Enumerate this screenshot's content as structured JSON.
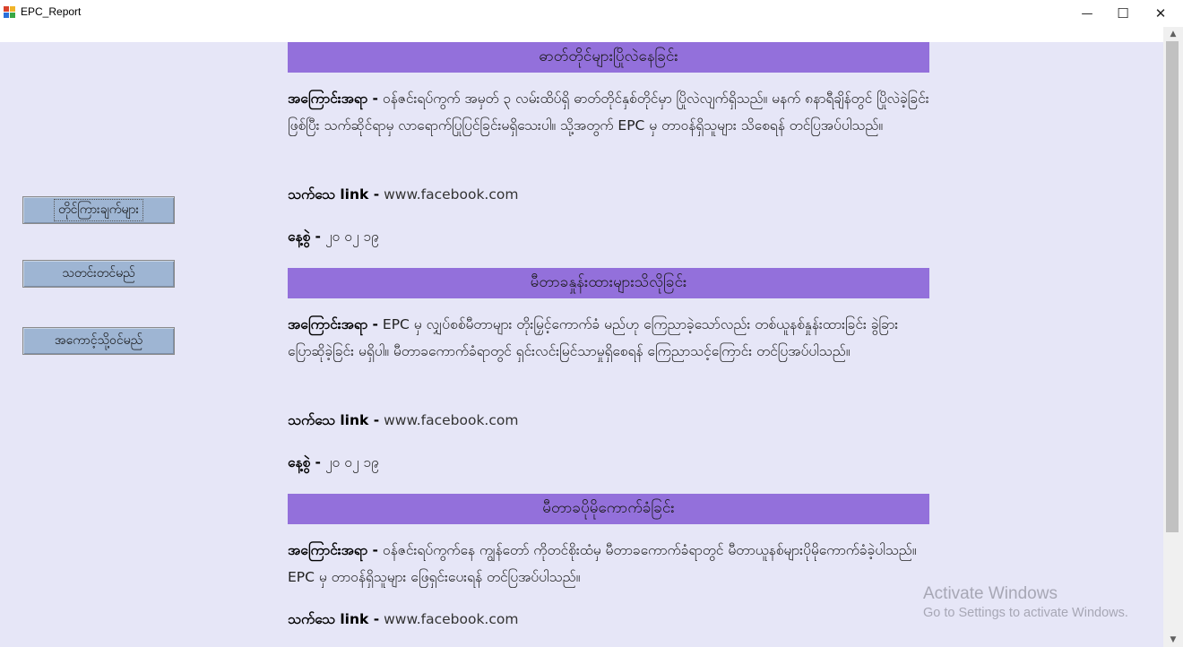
{
  "window": {
    "title": "EPC_Report",
    "minimize": "—",
    "maximize": "☐",
    "close": "✕"
  },
  "sidebar": {
    "buttons": [
      {
        "label": "တိုင်ကြားချက်များ"
      },
      {
        "label": "သတင်းတင်မည်"
      },
      {
        "label": "အကောင့်သို့ဝင်မည်"
      }
    ]
  },
  "posts": [
    {
      "title": "ဓာတ်တိုင်များပြိုလဲနေခြင်း",
      "reason_label": "အကြောင်းအရာ -",
      "reason_text": "ဝန်ဇင်းရပ်ကွက် အမှတ် ၃ လမ်းထိပ်ရှိ ဓာတ်တိုင်နှစ်တိုင်မှာ ပြိုလဲလျက်ရှိသည်။ မနက် ၈နာရီချိန်တွင် ပြိုလဲခဲ့ခြင်း ဖြစ်ပြီး သက်ဆိုင်ရာမှ လာရောက်ပြုပြင်ခြင်းမရှိသေးပါ။ သို့အတွက် EPC မှ တာဝန်ရှိသူများ သိစေရန် တင်ပြအပ်ပါသည်။",
      "link_label": "သက်သေ link -",
      "link_value": "www.facebook.com",
      "date_label": "နေ့စွဲ -",
      "date_value": "၂၀ ၀၂ ၁၉"
    },
    {
      "title": "မီတာခနှုန်းထားများသိလိုခြင်း",
      "reason_label": "အကြောင်းအရာ -",
      "reason_text": "EPC မှ လျှပ်စစ်မီတာများ တိုးမြှင့်ကောက်ခံ မည်ဟု ကြေညာခဲ့သော်လည်း တစ်ယူနစ်နှုန်းထားခြင်း ခွဲခြားပြောဆိုခဲ့ခြင်း မရှိပါ။ မီတာခကောက်ခံရာတွင် ရှင်းလင်းမြင်သာမှုရှိစေရန် ကြေညာသင့်ကြောင်း တင်ပြအပ်ပါသည်။",
      "link_label": "သက်သေ link -",
      "link_value": "www.facebook.com",
      "date_label": "နေ့စွဲ -",
      "date_value": "၂၀ ၀၂ ၁၉"
    },
    {
      "title": "မီတာခပိုမိုကောက်ခံခြင်း",
      "reason_label": "အကြောင်းအရာ -",
      "reason_text": "ဝန်ဇင်းရပ်ကွက်နေ ကျွန်တော် ကိုတင်စိုးထံမှ မီတာခကောက်ခံရာတွင် မီတာယူနစ်များပိုမိုကောက်ခံခဲ့ပါသည်။ EPC မှ တာဝန်ရှိသူများ ဖြေရှင်းပေးရန် တင်ပြအပ်ပါသည်။",
      "link_label": "သက်သေ link -",
      "link_value": "www.facebook.com"
    }
  ],
  "watermark": {
    "line1": "Activate Windows",
    "line2": "Go to Settings to activate Windows."
  },
  "colors": {
    "heading_bg": "#9370db",
    "content_bg": "#e6e6f7",
    "button_bg": "#9eb5d3"
  }
}
